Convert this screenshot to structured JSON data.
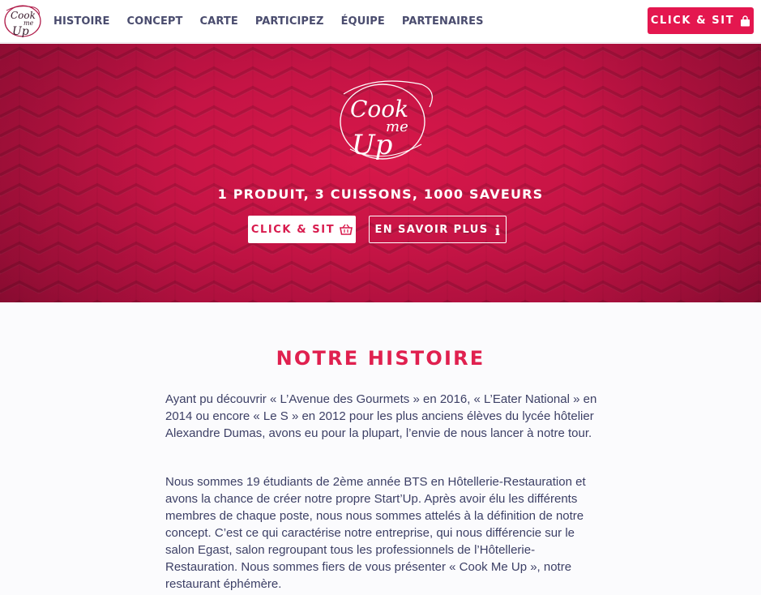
{
  "brand": {
    "logo_text": [
      "Cook",
      "me",
      "Up"
    ]
  },
  "nav": {
    "items": [
      {
        "label": "HISTOIRE"
      },
      {
        "label": "CONCEPT"
      },
      {
        "label": "CARTE"
      },
      {
        "label": "PARTICIPEZ"
      },
      {
        "label": "ÉQUIPE"
      },
      {
        "label": "PARTENAIRES"
      }
    ],
    "cta_label": "CLICK & SIT",
    "cta_icon": "shopping-bag-icon"
  },
  "hero": {
    "tagline": "1 PRODUIT, 3 CUISSONS, 1000 SAVEURS",
    "primary_button": {
      "label": "CLICK & SIT",
      "icon": "basket-icon"
    },
    "secondary_button": {
      "label": "EN SAVOIR PLUS",
      "icon": "info-icon"
    }
  },
  "histoire": {
    "title": "NOTRE HISTOIRE",
    "paragraphs": [
      "Ayant pu découvrir « L’Avenue des Gourmets » en 2016, « L’Eater National » en 2014 ou encore « Le S » en 2012 pour les plus anciens élèves du lycée hôtelier Alexandre Dumas, avons eu pour la plupart, l’envie de nous lancer à notre tour.",
      "Nous sommes 19 étudiants de 2ème année BTS en Hôtellerie-Restauration et avons la chance de créer notre propre Start’Up. Après avoir élu les différents membres de chaque poste, nous nous sommes attelés à la définition de notre concept. C’est ce qui caractérise notre entreprise, qui nous différencie sur le salon Egast, salon regroupant tous les professionnels de l’Hôtellerie-Restauration. Nous sommes fiers de vous présenter « Cook Me Up », notre restaurant éphémère."
    ]
  },
  "colors": {
    "accent": "#e4174f",
    "hero_bg": "#c51445",
    "text": "#3d4066"
  }
}
